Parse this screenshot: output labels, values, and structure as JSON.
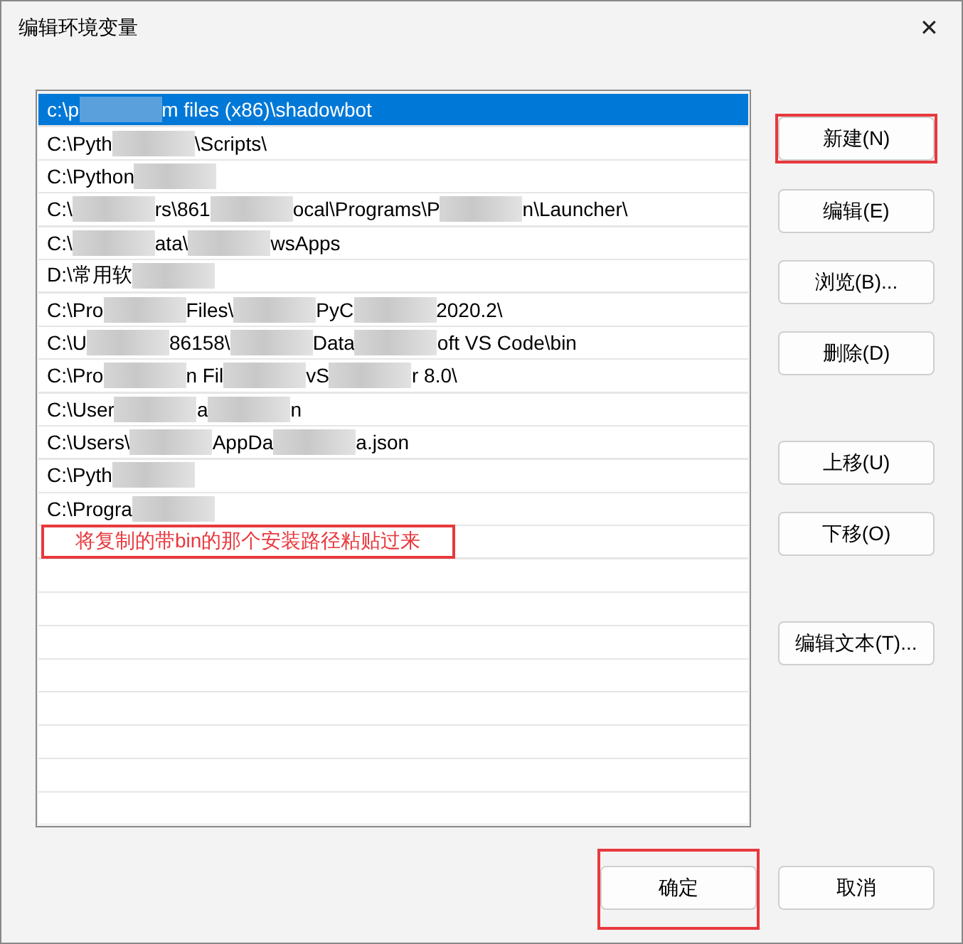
{
  "window": {
    "title": "编辑环境变量",
    "close": "✕"
  },
  "path_list": [
    {
      "parts": [
        "c:\\p",
        "m files (x86)\\shadowbot"
      ],
      "selected": true
    },
    {
      "parts": [
        "C:\\Pyth",
        "\\Scripts\\"
      ],
      "selected": false
    },
    {
      "parts": [
        "C:\\Python"
      ],
      "blur_end": true,
      "selected": false
    },
    {
      "parts": [
        "C:\\",
        "rs\\861",
        "ocal\\Programs\\P",
        "n\\Launcher\\"
      ],
      "selected": false
    },
    {
      "parts": [
        "C:\\",
        "ata\\",
        "wsApps"
      ],
      "selected": false
    },
    {
      "parts": [
        "D:\\常用软"
      ],
      "blur_end": true,
      "selected": false
    },
    {
      "parts": [
        "C:\\Pro",
        "Files\\",
        "PyC",
        "2020.2\\"
      ],
      "selected": false
    },
    {
      "parts": [
        "C:\\U",
        "86158\\",
        "Data",
        "oft VS Code\\bin"
      ],
      "selected": false
    },
    {
      "parts": [
        "C:\\Pro",
        "n Fil",
        "vS",
        "r 8.0\\"
      ],
      "selected": false
    },
    {
      "parts": [
        "C:\\User",
        "a",
        "n"
      ],
      "selected": false
    },
    {
      "parts": [
        "C:\\Users\\",
        "AppDa",
        "a.json"
      ],
      "selected": false
    },
    {
      "parts": [
        "C:\\Pyth"
      ],
      "blur_end": true,
      "selected": false
    },
    {
      "parts": [
        "C:\\Progra"
      ],
      "blur_end": true,
      "selected": false
    }
  ],
  "annotation": "将复制的带bin的那个安装路径粘贴过来",
  "side_buttons": [
    {
      "label": "新建(N)",
      "highlighted": true
    },
    {
      "label": "编辑(E)",
      "highlighted": false
    },
    {
      "label": "浏览(B)...",
      "highlighted": false
    },
    {
      "label": "删除(D)",
      "highlighted": false
    },
    {
      "label": "上移(U)",
      "highlighted": false
    },
    {
      "label": "下移(O)",
      "highlighted": false
    },
    {
      "label": "编辑文本(T)...",
      "highlighted": false
    }
  ],
  "footer_buttons": [
    {
      "label": "确定",
      "highlighted": true
    },
    {
      "label": "取消",
      "highlighted": false
    }
  ]
}
